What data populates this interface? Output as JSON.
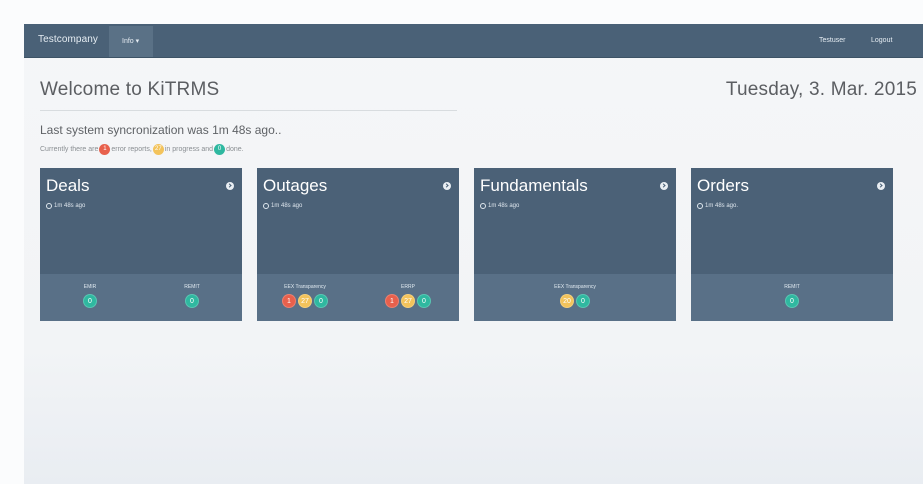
{
  "navbar": {
    "brand": "Testcompany",
    "info_menu": "Info ▾",
    "user": "Testuser",
    "logout": "Logout"
  },
  "header": {
    "welcome": "Welcome to KiTRMS",
    "date": "Tuesday, 3. Mar. 2015",
    "sync": "Last system syncronization was 1m 48s ago..",
    "status": {
      "prefix": "Currently there are",
      "error_count": "1",
      "error_text": "error reports,",
      "progress_count": "27",
      "progress_text": "in progress and",
      "done_count": "0",
      "done_text": "done."
    }
  },
  "cards": [
    {
      "title": "Deals",
      "time": "1m 48s ago",
      "groups": [
        {
          "label": "EMIR",
          "badges": [
            {
              "value": "0",
              "color": "green"
            }
          ]
        },
        {
          "label": "REMIT",
          "badges": [
            {
              "value": "0",
              "color": "green"
            }
          ]
        }
      ]
    },
    {
      "title": "Outages",
      "time": "1m 48s ago",
      "groups": [
        {
          "label": "EEX Transparency",
          "badges": [
            {
              "value": "1",
              "color": "red"
            },
            {
              "value": "27",
              "color": "yellow"
            },
            {
              "value": "0",
              "color": "green"
            }
          ]
        },
        {
          "label": "ERRP",
          "badges": [
            {
              "value": "1",
              "color": "red"
            },
            {
              "value": "27",
              "color": "yellow"
            },
            {
              "value": "0",
              "color": "green"
            }
          ]
        }
      ]
    },
    {
      "title": "Fundamentals",
      "time": "1m 48s ago",
      "groups": [
        {
          "label": "EEX Transparency",
          "badges": [
            {
              "value": "20",
              "color": "yellow"
            },
            {
              "value": "0",
              "color": "green"
            }
          ]
        }
      ]
    },
    {
      "title": "Orders",
      "time": "1m 48s ago.",
      "groups": [
        {
          "label": "REMIT",
          "badges": [
            {
              "value": "0",
              "color": "green"
            }
          ]
        }
      ]
    }
  ],
  "colors": {
    "navbar": "#4a6177",
    "card": "#4b6177",
    "card_footer": "#597087",
    "red": "#e8604c",
    "yellow": "#f3c35b",
    "green": "#2fb8a0"
  },
  "icons": {
    "time": "clock-icon",
    "card_link": "arrow-right-circle-icon"
  }
}
